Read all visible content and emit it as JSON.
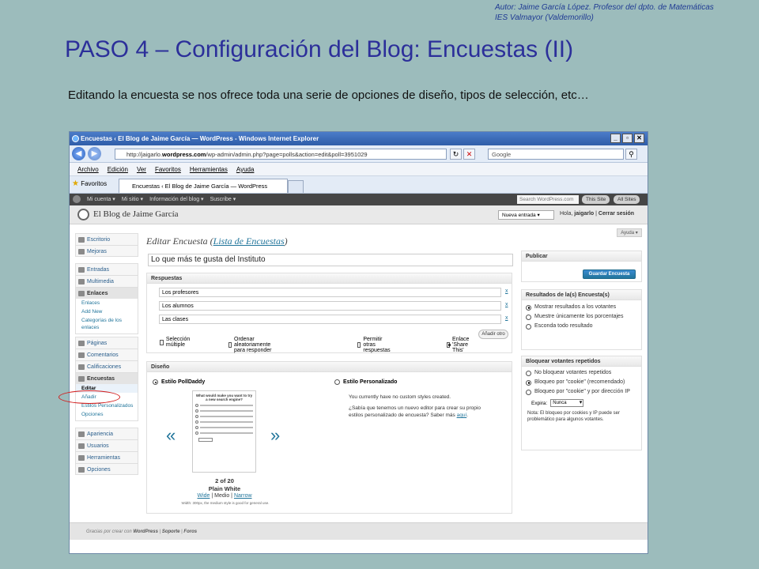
{
  "slide": {
    "author_line1": "Autor: Jaime García López. Profesor del dpto. de Matemáticas",
    "author_line2": "IES Valmayor (Valdemorillo)",
    "title": "PASO 4 – Configuración del Blog: Encuestas (II)",
    "subtitle": "Editando la encuesta se nos ofrece toda una serie de opciones de diseño, tipos de selección, etc…"
  },
  "browser": {
    "window_title": "Encuestas ‹ El Blog de Jaime García — WordPress - Windows Internet Explorer",
    "url_prefix": "http://jaigarlo.",
    "url_domain": "wordpress.com",
    "url_rest": "/wp-admin/admin.php?page=polls&action=edit&poll=3951029",
    "search_placeholder": "Google",
    "menu": [
      "Archivo",
      "Edición",
      "Ver",
      "Favoritos",
      "Herramientas",
      "Ayuda"
    ],
    "favorites_label": "Favoritos",
    "tab_label": "Encuestas ‹ El Blog de Jaime García — WordPress"
  },
  "admin_bar": {
    "items": [
      "Mi cuenta ▾",
      "Mi sitio ▾",
      "Información del blog ▾",
      "Suscribe ▾"
    ],
    "search_placeholder": "Search WordPress.com",
    "this_site": "This Site",
    "all_sites": "All Sites"
  },
  "wp_header": {
    "blog_name": "El Blog de Jaime García",
    "new_entry": "Nueva entrada",
    "greeting": "Hola, ",
    "user": "jaigarlo",
    "separator": " | ",
    "logout": "Cerrar sesión",
    "help": "Ayuda ▾"
  },
  "sidebar": {
    "top": [
      "Escritorio",
      "Mejoras"
    ],
    "group2": [
      "Entradas",
      "Multimedia",
      "Enlaces"
    ],
    "enlaces_sub": [
      "Enlaces",
      "Add New",
      "Categorías de los enlaces"
    ],
    "group3": [
      "Páginas",
      "Comentarios",
      "Calificaciones"
    ],
    "encuestas": "Encuestas",
    "encuestas_sub": [
      "Editar",
      "Añadir",
      "Estilos Personalizados",
      "Opciones"
    ],
    "group4": [
      "Apariencia",
      "Usuarios",
      "Herramientas",
      "Opciones"
    ]
  },
  "editor": {
    "heading_prefix": "Editar Encuesta (",
    "heading_link": "Lista de Encuestas",
    "heading_suffix": ")",
    "question": "Lo que más te gusta del Instituto",
    "answers_title": "Respuestas",
    "answers": [
      "Los profesores",
      "Los alumnos",
      "Las clases"
    ],
    "remove": "x",
    "add_other": "Añadir otro",
    "options": [
      "Selección múltiple",
      "Ordenar aleatoriamente para responder",
      "Permitir otras respuestas",
      "Enlace 'Share This'"
    ],
    "options_checked": [
      false,
      false,
      false,
      true
    ]
  },
  "design": {
    "title": "Diseño",
    "style_polldaddy": "Estilo PollDaddy",
    "style_custom": "Estilo Personalizado",
    "preview_title": "What would make you want to try a new search engine?",
    "prev": "«",
    "next": "»",
    "count": "2 of 20",
    "style_name": "Plain White",
    "size_wide": "Wide",
    "size_sep1": " | ",
    "size_medium": "Medio",
    "size_sep2": " | ",
    "size_narrow": "Narrow",
    "size_note": "Width: 300px, the medium style is good for general use.",
    "custom_line1": "You currently have no custom styles created.",
    "custom_line2": "¿Sabía que tenemos un nuevo editor para crear su propio estilos personalizado de encuesta? Saber más ",
    "custom_link": "aquí",
    "custom_end": "."
  },
  "publish": {
    "title": "Publicar",
    "save": "Guardar Encuesta"
  },
  "results": {
    "title": "Resultados de la(s) Encuesta(s)",
    "options": [
      "Mostrar resultados a los votantes",
      "Muestre únicamente los porcentajes",
      "Esconda todo resultado"
    ],
    "selected": 0
  },
  "block": {
    "title": "Bloquear votantes repetidos",
    "options": [
      "No bloquear votantes repetidos",
      "Bloqueo por \"cookie\" (recomendado)",
      "Bloqueo por \"cookie\" y por dirección IP"
    ],
    "selected": 1,
    "expira_label": "Expira:",
    "expira_value": "Nunca",
    "note": "Nota: El bloqueo por cookies y IP puede ser problemático para algunos votantes."
  },
  "footer": {
    "prefix": "Gracias por crear con ",
    "brand": "WordPress",
    "sep1": " | ",
    "support": "Soporte",
    "sep2": " | ",
    "forums": "Foros"
  },
  "colors": {
    "slide_bg": "#9cbcbc",
    "title": "#2c2f9a",
    "wp_link": "#21759b",
    "highlight": "#d21d1d"
  }
}
